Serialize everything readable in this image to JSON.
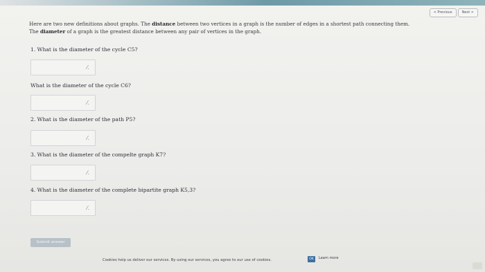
{
  "nav": {
    "previous": "< Previous",
    "next": "Next >"
  },
  "intro": {
    "line1_before": "Here are two new definitions about graphs. The ",
    "line1_bold": "distance",
    "line1_after": " between two vertices in a graph is the number of edges in a shortest path connecting them.",
    "line2_before": "The ",
    "line2_bold": "diameter",
    "line2_after": " of a graph is the greatest distance between any pair of vertices in the graph."
  },
  "questions": [
    {
      "text": "1. What is the diameter of the cycle C5?"
    },
    {
      "text": "What is the diameter of the cycle C6?"
    },
    {
      "text": "2. What is the diameter of the path P5?"
    },
    {
      "text": "3. What is the diameter of the compelte graph K7?"
    },
    {
      "text": "4. What is the diameter of the complete bipartite graph K5,3?"
    }
  ],
  "answers": [
    "",
    "",
    "",
    "",
    ""
  ],
  "submit_label": "Submit answer",
  "cookie": {
    "text": "Cookies help us deliver our services. By using our services, you agree to our use of cookies.",
    "ok_label": "OK",
    "learn_label": "Learn more"
  },
  "colors": {
    "ok_button": "#3f6fa0",
    "submit_button": "#b7c1c7"
  }
}
